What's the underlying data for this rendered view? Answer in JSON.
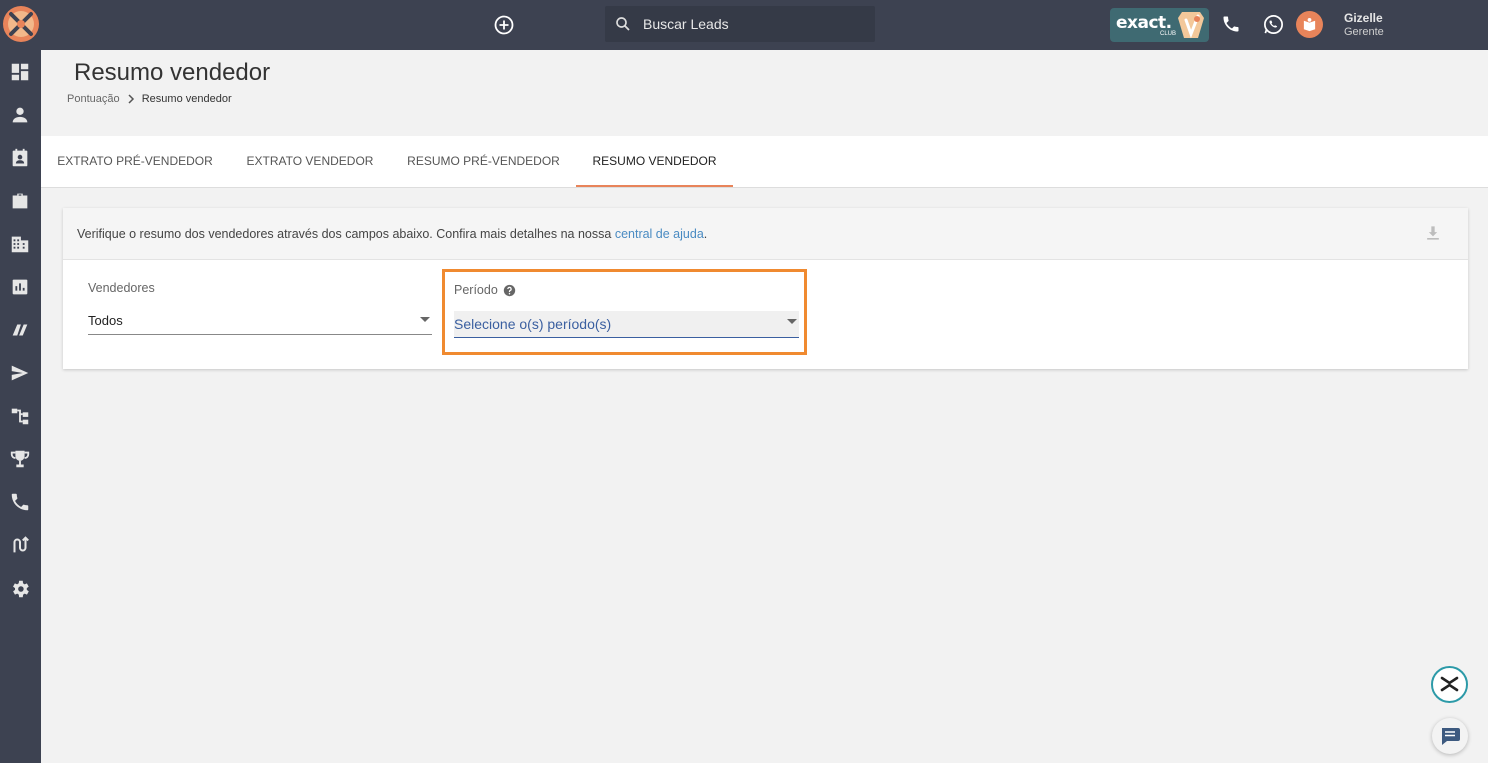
{
  "topbar": {
    "search_placeholder": "Buscar Leads",
    "club_word": "exact.",
    "club_sub": "CLUB",
    "user_name": "Gizelle",
    "user_role": "Gerente"
  },
  "sidebar": {
    "items": [
      "dashboard-icon",
      "person-icon",
      "contacts-icon",
      "briefcase-icon",
      "building-icon",
      "chart-icon",
      "tag-icon",
      "send-icon",
      "hierarchy-icon",
      "trophy-icon",
      "phone-icon",
      "route-icon",
      "gear-icon"
    ]
  },
  "page": {
    "title": "Resumo vendedor",
    "breadcrumb": [
      "Pontuação",
      "Resumo vendedor"
    ]
  },
  "tabs": [
    {
      "label": "EXTRATO PRÉ-VENDEDOR",
      "active": false
    },
    {
      "label": "EXTRATO VENDEDOR",
      "active": false
    },
    {
      "label": "RESUMO PRÉ-VENDEDOR",
      "active": false
    },
    {
      "label": "RESUMO VENDEDOR",
      "active": true
    }
  ],
  "card": {
    "info_text": "Verifique o resumo dos vendedores através dos campos abaixo. Confira mais detalhes na nossa ",
    "info_link": "central de ajuda",
    "info_end": ".",
    "vendedores_label": "Vendedores",
    "vendedores_value": "Todos",
    "periodo_label": "Período",
    "periodo_placeholder": "Selecione o(s) período(s)"
  },
  "colors": {
    "topbar": "#3d4251",
    "accent": "#e8845a",
    "highlight": "#f08a30",
    "link": "#4a8bc2"
  }
}
